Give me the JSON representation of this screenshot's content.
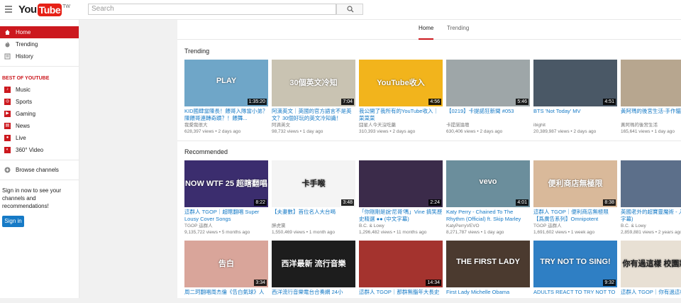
{
  "header": {
    "logo_you": "You",
    "logo_tube": "Tube",
    "region": "TW",
    "search_placeholder": "Search"
  },
  "sidebar": {
    "nav": [
      {
        "label": "Home",
        "icon": "home-icon",
        "active": true
      },
      {
        "label": "Trending",
        "icon": "flame-icon",
        "active": false
      },
      {
        "label": "History",
        "icon": "history-icon",
        "active": false
      }
    ],
    "best_heading": "BEST OF YOUTUBE",
    "best": [
      {
        "label": "Music",
        "icon": "music-icon"
      },
      {
        "label": "Sports",
        "icon": "sports-icon"
      },
      {
        "label": "Gaming",
        "icon": "gaming-icon"
      },
      {
        "label": "News",
        "icon": "news-icon"
      },
      {
        "label": "Live",
        "icon": "live-icon"
      },
      {
        "label": "360° Video",
        "icon": "360-video-icon"
      }
    ],
    "browse_channels": "Browse channels",
    "signin_text": "Sign in now to see your channels and recommendations!",
    "signin_button": "Sign in"
  },
  "feed_tabs": [
    {
      "label": "Home",
      "selected": true
    },
    {
      "label": "Trending",
      "selected": false
    }
  ],
  "shelves": [
    {
      "title": "Trending",
      "videos": [
        {
          "title": "KID國肆當陳長！餵哥入隊當小弟？陳餵哥連轉奇蹟？！餵舞...",
          "channel": "我愛我很大",
          "views": "628,397 views",
          "age": "2 days ago",
          "duration": "1:35:20",
          "thumb_text": "PLAY",
          "bg": "#6fa6c8"
        },
        {
          "title": "阿滴英文｜英國的官方語言不是英文？30個好玩的英文冷知識！",
          "channel": "阿滴英文",
          "views": "98,732 views",
          "age": "1 day ago",
          "duration": "7:04",
          "thumb_text": "30個英文冷知",
          "bg": "#c9c3b2"
        },
        {
          "title": "我公開了我所有的YouTube收入｜菜菜菜",
          "channel": "囧星人今天沒吃藥",
          "views": "310,393 views",
          "age": "2 days ago",
          "duration": "4:56",
          "thumb_text": "YouTube收入",
          "bg": "#f2b41c"
        },
        {
          "title": "【0219】卡提諾狂新聞 #053",
          "channel": "卡提諾論壇",
          "views": "630,406 views",
          "age": "2 days ago",
          "duration": "5:46",
          "thumb_text": "",
          "bg": "#9ea6a8"
        },
        {
          "title": "BTS 'Not Today' MV",
          "channel": "ibighit",
          "views": "20,389,987 views",
          "age": "2 days ago",
          "duration": "4:51",
          "thumb_text": "",
          "bg": "#4a5866"
        },
        {
          "title": "黃阿瑪的後宮生活-手作貓...",
          "channel": "黃阿瑪的後宮生活",
          "views": "165,641 views",
          "age": "1 day ago",
          "duration": "",
          "thumb_text": "",
          "bg": "#b7a68f"
        }
      ]
    },
    {
      "title": "Recommended",
      "videos": [
        {
          "title": "這群人 TGOP｜超瞎翻唱 Super Lousy Cover Songs",
          "channel": "TGOP 這群人",
          "views": "9,135,722 views",
          "age": "5 months ago",
          "duration": "8:22",
          "thumb_text": "NOW WTF 25 超瞎翻唱",
          "bg": "#3b2d6e"
        },
        {
          "title": "【夫妻數】首位名人大台喝",
          "channel": "胖虎黨",
          "views": "1,550,469 views",
          "age": "1 month ago",
          "duration": "3:48",
          "thumb_text": "卡手喉",
          "bg": "#f4f4f4"
        },
        {
          "title": "「你剛剛是說'尼哥'嗎」Vine 搞笑歷史精選 ●● (中文字幕)",
          "channel": "B.C. & Lowy",
          "views": "1,296,482 views",
          "age": "11 months ago",
          "duration": "2:24",
          "thumb_text": "",
          "bg": "#3b2b4a"
        },
        {
          "title": "Katy Perry - Chained To The Rhythm (Official) ft. Skip Marley",
          "channel": "KatyPerryVEVO",
          "views": "8,271,787 views",
          "age": "1 day ago",
          "duration": "4:01",
          "thumb_text": "vevo",
          "bg": "#6b8e9c"
        },
        {
          "title": "這群人 TGOP｜便利商店無極限【爲廣告系列】Omnipotent",
          "channel": "TGOP 這群人",
          "views": "1,691,602 views",
          "age": "1 week ago",
          "duration": "8:38",
          "thumb_text": "便利商店無極限",
          "bg": "#d9b99a"
        },
        {
          "title": "英國老外的超寶靈魔術 - 入帖 (中文字幕)",
          "channel": "B.C. & Lowy",
          "views": "2,859,881 views",
          "age": "2 years ago",
          "duration": "",
          "thumb_text": "",
          "bg": "#5c6f8a"
        }
      ]
    },
    {
      "title": "",
      "videos": [
        {
          "title": "周二珂翻唱周杰倫《告白氣球》人",
          "channel": "",
          "views": "",
          "age": "",
          "duration": "3:34",
          "thumb_text": "告白",
          "bg": "#d9a59a"
        },
        {
          "title": "西洋流行音樂電台合奏網 24小",
          "channel": "",
          "views": "",
          "age": "",
          "duration": "",
          "thumb_text": "西洋最新 流行音樂",
          "bg": "#1d1d1d"
        },
        {
          "title": "這群人 TGOP｜那群無腦年大長史",
          "channel": "",
          "views": "",
          "age": "",
          "duration": "14:34",
          "thumb_text": "",
          "bg": "#a4332e"
        },
        {
          "title": "First Lady Michelle Obama",
          "channel": "",
          "views": "",
          "age": "",
          "duration": "",
          "thumb_text": "THE FIRST LADY",
          "bg": "#4b3a2f"
        },
        {
          "title": "ADULTS REACT TO TRY NOT TO",
          "channel": "",
          "views": "",
          "age": "",
          "duration": "9:32",
          "thumb_text": "TRY NOT TO SING!",
          "bg": "#2f7fc4"
        },
        {
          "title": "這群人 TGOP｜你有過這樣",
          "channel": "",
          "views": "",
          "age": "",
          "duration": "",
          "thumb_text": "你有過這樣 校園狀況嗎",
          "bg": "#e8e0d4"
        }
      ]
    }
  ]
}
